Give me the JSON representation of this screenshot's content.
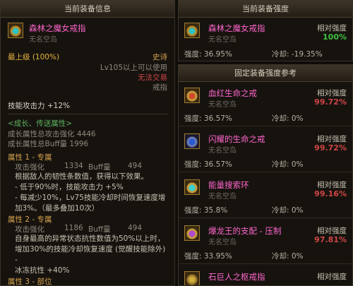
{
  "left": {
    "title": "当前装备信息",
    "item_name": "森林之魔女戒指",
    "item_sub": "无名空岛",
    "top_level": "最上级 (100%)",
    "rarity": "史诗",
    "level_req": "Lv105以上可以使用",
    "trade": "无法交易",
    "type": "戒指",
    "skill_atk": "技能攻击力 +12%",
    "growth_header": "<成长、传送属性>",
    "growth_atk": "成长属性总攻击强化 4446",
    "growth_buff": "成长属性总Buff量 1996",
    "attr1": {
      "title": "属性 1 - 专属",
      "atk_label": "攻击强化",
      "atk_val": "1334",
      "buff_label": "Buff量",
      "buff_val": "494",
      "lines": [
        "根据敌人的韧性条数值，获得以下效果。",
        "- 低于90%时，技能攻击力 +5%",
        "- 每减少10%，Lv75技能冷却时间恢复速度增",
        "加3%。（最多叠加10次）"
      ]
    },
    "attr2": {
      "title": "属性 2 - 专属",
      "atk_label": "攻击强化",
      "atk_val": "1186",
      "buff_label": "Buff量",
      "buff_val": "494",
      "lines": [
        "自身最高的异常状态抗性数值为50%以上时，",
        "增加30%的技能冷却恢复速度 (觉醒技能除外)",
        "-",
        "冰冻抗性 +40%"
      ]
    },
    "attr3_title": "属性 3 - 部位"
  },
  "current": {
    "title": "当前装备强度",
    "name": "森林之魔女戒指",
    "sub": "无名空岛",
    "rel_label": "相对强度",
    "rel_val": "100%",
    "strength": "强度: 36.95%",
    "cooldown": "冷却: -19.35%"
  },
  "reference": {
    "title": "固定装备强度参考",
    "items": [
      {
        "name": "血红生命之戒",
        "sub": "无名空岛",
        "rel_label": "相对强度",
        "rel_val": "99.72%",
        "strength": "强度: 36.57%",
        "cooldown": "冷却: 0%",
        "icon": "ring-icon"
      },
      {
        "name": "闪耀的生命之戒",
        "sub": "无名空岛",
        "rel_label": "相对强度",
        "rel_val": "99.72%",
        "strength": "强度: 36.57%",
        "cooldown": "冷却: 0%",
        "icon": "ring-icon"
      },
      {
        "name": "能量搜索环",
        "sub": "无名空岛",
        "rel_label": "相对强度",
        "rel_val": "99.16%",
        "strength": "强度: 35.8%",
        "cooldown": "冷却: 0%",
        "icon": "ring-icon"
      },
      {
        "name": "爆龙王的支配 - 压制",
        "sub": "无名空岛",
        "rel_label": "相对强度",
        "rel_val": "97.81%",
        "strength": "强度: 33.95%",
        "cooldown": "冷却: 0%",
        "icon": "ring-icon"
      },
      {
        "name": "石巨人之枢戒指",
        "sub": "",
        "rel_label": "相对强度",
        "rel_val": "",
        "strength": "",
        "cooldown": "",
        "icon": "ring-icon"
      }
    ]
  },
  "colors": {
    "epic": "#ff66cc",
    "gold": "#e6b43c",
    "red": "#d04545",
    "green": "#40c040"
  }
}
